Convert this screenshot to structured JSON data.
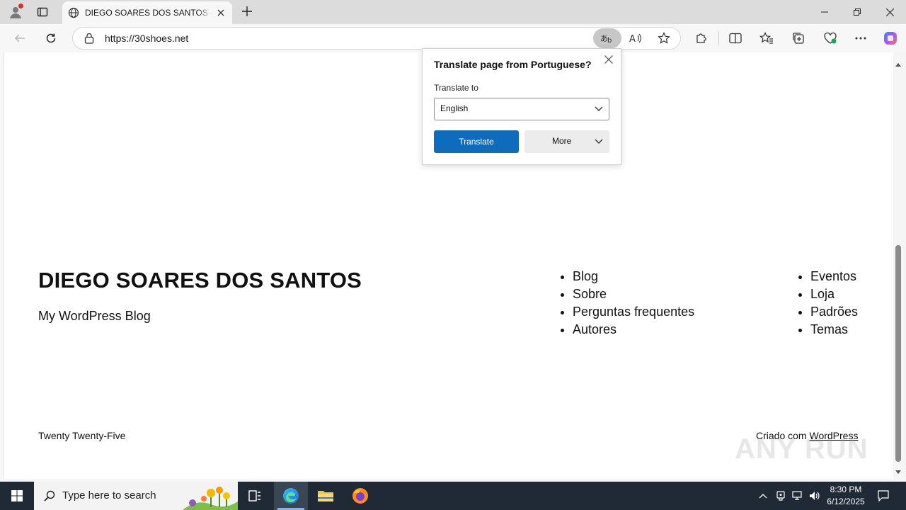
{
  "browser": {
    "tab_title": "DIEGO SOARES DOS SANTOS – My WordPress Blog",
    "url": "https://30shoes.net"
  },
  "translate_popup": {
    "title": "Translate page from Portuguese?",
    "label": "Translate to",
    "selected_language": "English",
    "translate_button": "Translate",
    "more_button": "More"
  },
  "page": {
    "site_title": "DIEGO SOARES DOS SANTOS",
    "tagline": "My WordPress Blog",
    "nav_col1": [
      "Blog",
      "Sobre",
      "Perguntas frequentes",
      "Autores"
    ],
    "nav_col2": [
      "Eventos",
      "Loja",
      "Padrões",
      "Temas"
    ],
    "footer_theme": "Twenty Twenty-Five",
    "footer_credit_prefix": "Criado com",
    "footer_credit_link": "WordPress"
  },
  "taskbar": {
    "search_placeholder": "Type here to search",
    "time": "8:30 PM",
    "date": "6/12/2025"
  },
  "watermark": "ANY RUN"
}
